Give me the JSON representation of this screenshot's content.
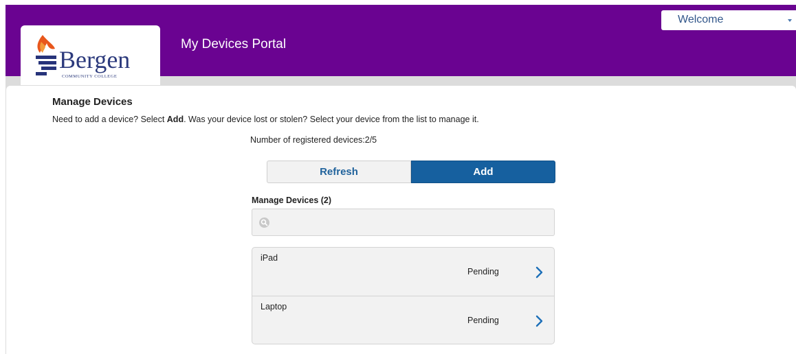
{
  "header": {
    "brand": {
      "name": "Bergen",
      "tagline": "COMMUNITY COLLEGE",
      "logo_icon": "torch-icon"
    },
    "app_title": "My Devices Portal",
    "user_menu": {
      "label": "Welcome",
      "icon": "caret-down-icon"
    },
    "accent_color": "#6a0391"
  },
  "main": {
    "section_title": "Manage Devices",
    "instructions": {
      "before": "Need to add a device? Select ",
      "emphasis": "Add",
      "after": ". Was your device lost or stolen? Select your device from the list to manage it."
    },
    "registered_count_text": "Number of registered devices:2/5",
    "buttons": {
      "refresh_label": "Refresh",
      "add_label": "Add"
    },
    "list_title": "Manage Devices (2)",
    "search": {
      "placeholder": "",
      "value": "",
      "icon": "search-icon"
    },
    "devices": [
      {
        "name": "iPad",
        "status": "Pending",
        "icon": "chevron-right-icon"
      },
      {
        "name": "Laptop",
        "status": "Pending",
        "icon": "chevron-right-icon"
      }
    ],
    "button_color": "#16609f"
  }
}
